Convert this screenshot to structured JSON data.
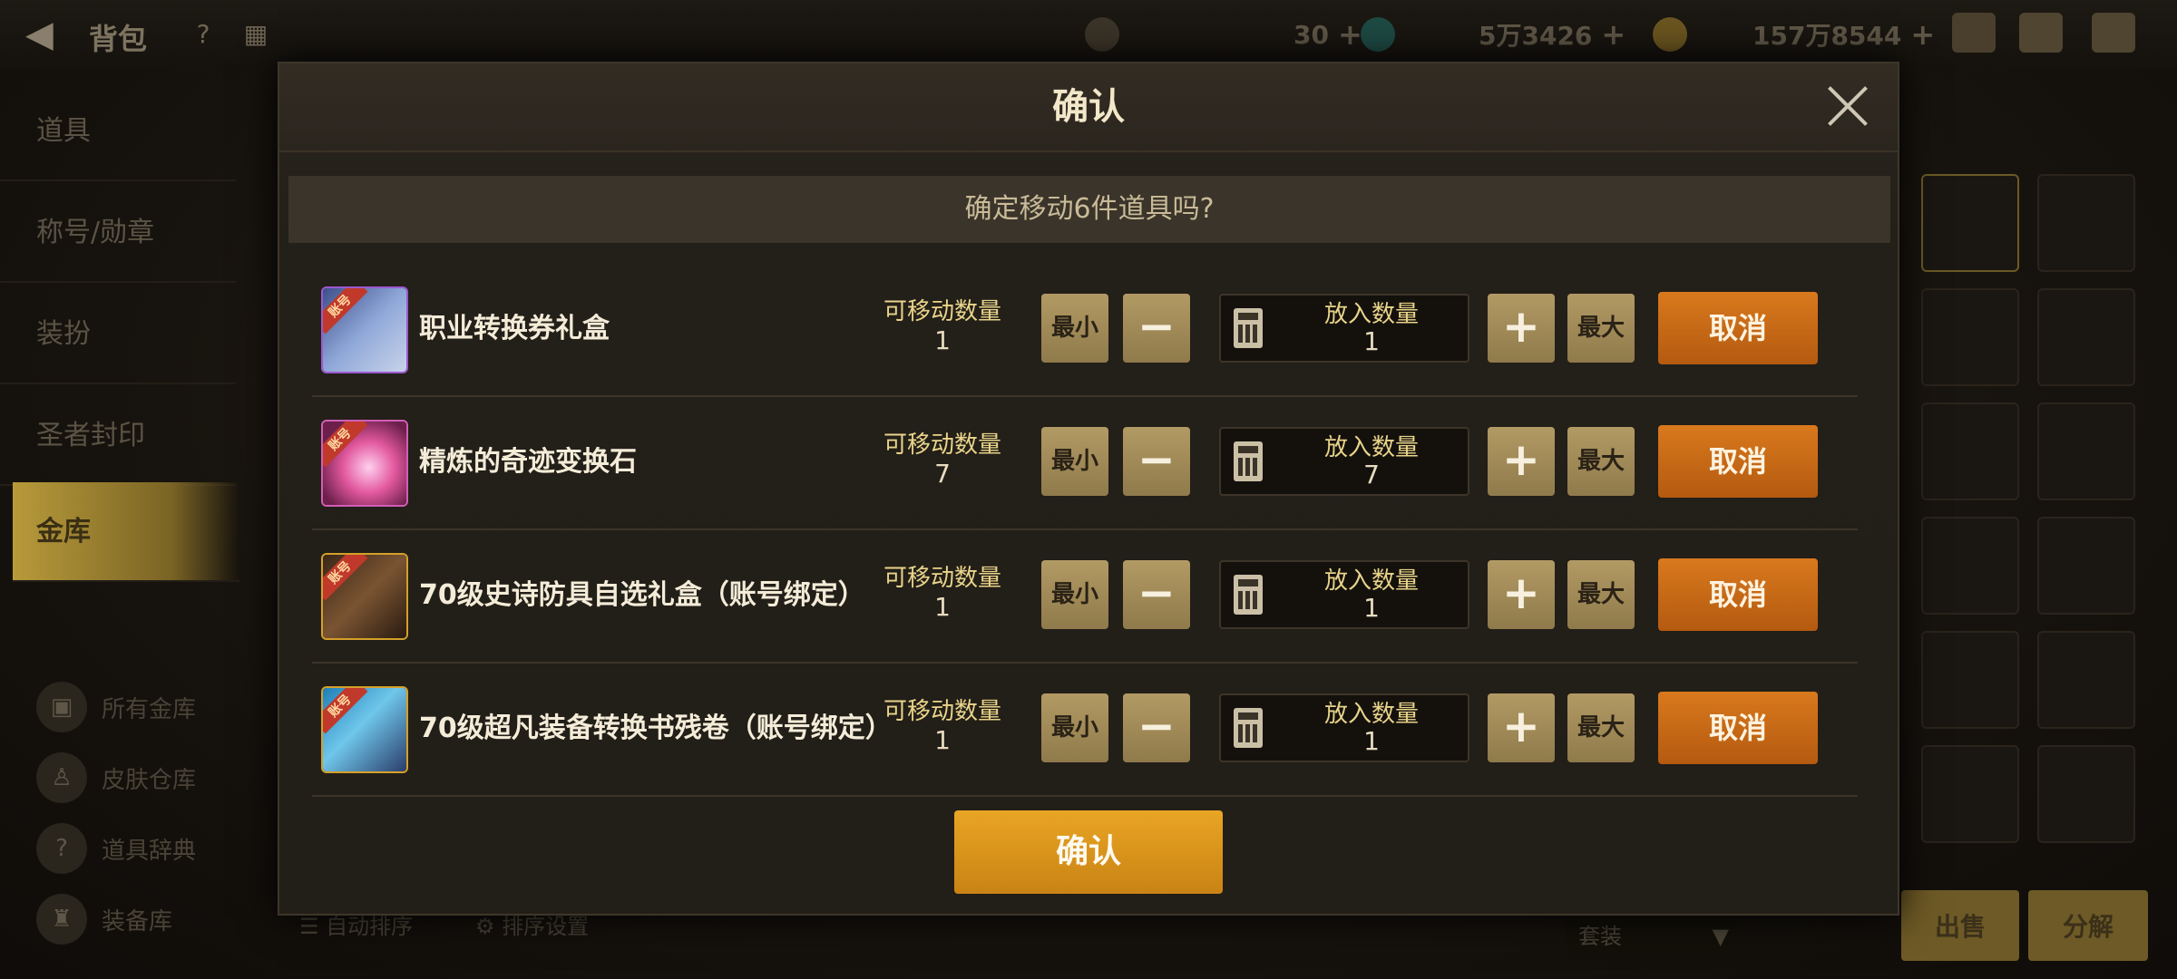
{
  "topbar": {
    "title": "背包",
    "currencies": [
      {
        "icon": "moon-coin-icon",
        "value": "30",
        "plus": "+"
      },
      {
        "icon": "gem-icon",
        "value": "5万3426",
        "plus": "+"
      },
      {
        "icon": "gold-coin-icon",
        "value": "157万8544",
        "plus": "+"
      }
    ]
  },
  "sidebar": {
    "items": [
      {
        "label": "道具"
      },
      {
        "label": "称号/勋章"
      },
      {
        "label": "装扮"
      },
      {
        "label": "圣者封印"
      },
      {
        "label": "金库"
      }
    ],
    "subitems": [
      {
        "label": "所有金库"
      },
      {
        "label": "皮肤仓库"
      },
      {
        "label": "道具辞典"
      },
      {
        "label": "装备库"
      }
    ]
  },
  "bottom": {
    "auto_sort": "自动排序",
    "sort_settings": "排序设置",
    "filter_value": "套装",
    "sell": "出售",
    "decompose": "分解"
  },
  "modal": {
    "title": "确认",
    "question": "确定移动6件道具吗?",
    "movable_label": "可移动数量",
    "qty_label": "放入数量",
    "min_label": "最小",
    "max_label": "最大",
    "minus": "−",
    "plus": "+",
    "cancel_label": "取消",
    "account_badge": "账号",
    "confirm_label": "确认",
    "rows": [
      {
        "name": "职业转换券礼盒",
        "movable": "1",
        "qty": "1",
        "icon": "gift-box-icon",
        "frame": "#9b59d0"
      },
      {
        "name": "精炼的奇迹变换石",
        "movable": "7",
        "qty": "7",
        "icon": "crystal-icon",
        "frame": "#d05fb5"
      },
      {
        "name": "70级史诗防具自选礼盒（账号绑定）",
        "movable": "1",
        "qty": "1",
        "icon": "armor-box-icon",
        "frame": "#d4a02a"
      },
      {
        "name": "70级超凡装备转换书残卷（账号绑定）",
        "movable": "1",
        "qty": "1",
        "icon": "scroll-icon",
        "frame": "#d4a02a"
      }
    ]
  }
}
